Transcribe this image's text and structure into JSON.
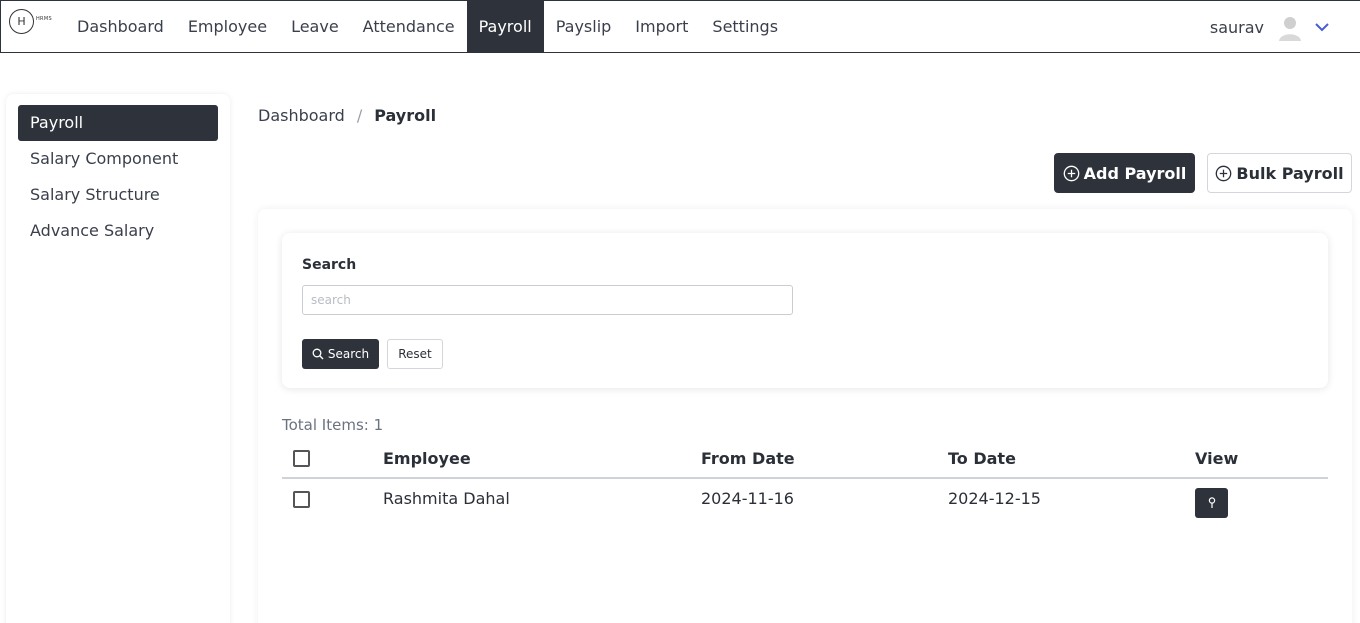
{
  "brand": {
    "logo_letter": "H",
    "logo_sub": "HRMS"
  },
  "nav": {
    "items": [
      {
        "label": "Dashboard"
      },
      {
        "label": "Employee"
      },
      {
        "label": "Leave"
      },
      {
        "label": "Attendance"
      },
      {
        "label": "Payroll",
        "active": true
      },
      {
        "label": "Payslip"
      },
      {
        "label": "Import"
      },
      {
        "label": "Settings"
      }
    ],
    "user_name": "saurav"
  },
  "sidebar": {
    "items": [
      {
        "label": "Payroll",
        "active": true
      },
      {
        "label": "Salary Component"
      },
      {
        "label": "Salary Structure"
      },
      {
        "label": "Advance Salary"
      }
    ]
  },
  "breadcrumb": {
    "parent": "Dashboard",
    "separator": "/",
    "current": "Payroll"
  },
  "actions": {
    "add_label": "Add Payroll",
    "bulk_label": "Bulk Payroll"
  },
  "search": {
    "label": "Search",
    "placeholder": "search",
    "value": "",
    "search_button": "Search",
    "reset_button": "Reset"
  },
  "total_items": "Total Items: 1",
  "table": {
    "headers": {
      "employee": "Employee",
      "from_date": "From Date",
      "to_date": "To Date",
      "view": "View"
    },
    "rows": [
      {
        "employee": "Rashmita Dahal",
        "from_date": "2024-11-16",
        "to_date": "2024-12-15"
      }
    ]
  },
  "colors": {
    "primary": "#2e323b",
    "accent_chevron": "#4a5bd4"
  }
}
